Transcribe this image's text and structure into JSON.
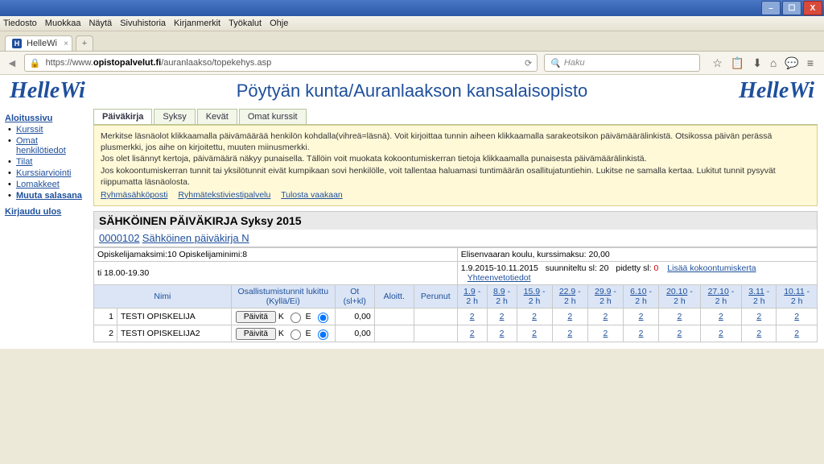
{
  "window": {
    "menus": [
      "Tiedosto",
      "Muokkaa",
      "Näytä",
      "Sivuhistoria",
      "Kirjanmerkit",
      "Työkalut",
      "Ohje"
    ],
    "tabTitle": "HelleWi",
    "url_prefix": "https://www.",
    "url_bold": "opistopalvelut.fi",
    "url_rest": "/auranlaakso/topekehys.asp",
    "searchPlaceholder": "Haku"
  },
  "brand": "HelleWi",
  "pageTitle": "Pöytyän kunta/Auranlaakson kansalaisopisto",
  "sidebar": {
    "home": "Aloitussivu",
    "items": [
      "Kurssit",
      "Omat henkilötiedot",
      "Tilat",
      "Kurssiarviointi",
      "Lomakkeet",
      "Muuta salasana"
    ],
    "logout": "Kirjaudu ulos"
  },
  "tabs": [
    "Päiväkirja",
    "Syksy",
    "Kevät",
    "Omat kurssit"
  ],
  "helpbox": {
    "l1": "Merkitse läsnäolot klikkaamalla päivämäärää henkilön kohdalla(vihreä=läsnä). Voit kirjoittaa tunnin aiheen klikkaamalla sarakeotsikon päivämäärälinkistä. Otsikossa päivän perässä plusmerkki, jos aihe on kirjoitettu, muuten miinusmerkki.",
    "l2": "Jos olet lisännyt kertoja, päivämäärä näkyy punaisella. Tällöin voit muokata kokoontumiskerran tietoja klikkaamalla punaisesta päivämäärälinkistä.",
    "l3": "Jos kokoontumiskerran tunnit tai yksilötunnit eivät kumpikaan sovi henkilölle, voit tallentaa haluamasi tuntimäärän osallitujatuntiehin. Lukitse ne samalla kertaa. Lukitut tunnit pysyvät riippumatta läsnäolosta.",
    "links": [
      "Ryhmäsähköposti",
      "Ryhmätekstiviestipalvelu",
      "Tulosta vaakaan"
    ]
  },
  "diary": {
    "title": "SÄHKÖINEN PÄIVÄKIRJA   Syksy    2015",
    "courseCode": "0000102",
    "courseName": "Sähköinen päiväkirja  N",
    "maxLine": "Opiskelijamaksimi:10 Opiskelijaminimi:8",
    "placeLine": "Elisenvaaran koulu,   kurssimaksu:  20,00",
    "timeLine": "ti   18.00-19.30",
    "dateSpan": "1.9.2015-10.11.2015",
    "plannedLbl": "suunniteltu sl:",
    "plannedVal": "20",
    "heldLbl": "pidetty sl:",
    "heldVal": "0",
    "link1": "Lisää kokoontumiskerta",
    "link2": "Yhteenvetotiedot",
    "cols": {
      "nimi": "Nimi",
      "osall": "Osallistumistunnit lukittu (Kyllä/Ei)",
      "ot": "Ot (sl+kl)",
      "aloitt": "Aloitt.",
      "perunut": "Perunut"
    },
    "dates": [
      {
        "d": "1.9",
        "h": "2 h"
      },
      {
        "d": "8.9",
        "h": "2 h"
      },
      {
        "d": "15.9",
        "h": "2 h"
      },
      {
        "d": "22.9",
        "h": "2 h"
      },
      {
        "d": "29.9",
        "h": "2 h"
      },
      {
        "d": "6.10",
        "h": "2 h"
      },
      {
        "d": "20.10",
        "h": "2 h"
      },
      {
        "d": "27.10",
        "h": "2 h"
      },
      {
        "d": "3.11",
        "h": "2 h"
      },
      {
        "d": "10.11",
        "h": "2 h"
      }
    ],
    "btnLabel": "Päivitä",
    "K": "K",
    "E": "E",
    "rows": [
      {
        "n": "1",
        "name": "TESTI OPISKELIJA",
        "ot": "0,00",
        "vals": [
          "2",
          "2",
          "2",
          "2",
          "2",
          "2",
          "2",
          "2",
          "2",
          "2"
        ]
      },
      {
        "n": "2",
        "name": "TESTI OPISKELIJA2",
        "ot": "0,00",
        "vals": [
          "2",
          "2",
          "2",
          "2",
          "2",
          "2",
          "2",
          "2",
          "2",
          "2"
        ]
      }
    ]
  }
}
